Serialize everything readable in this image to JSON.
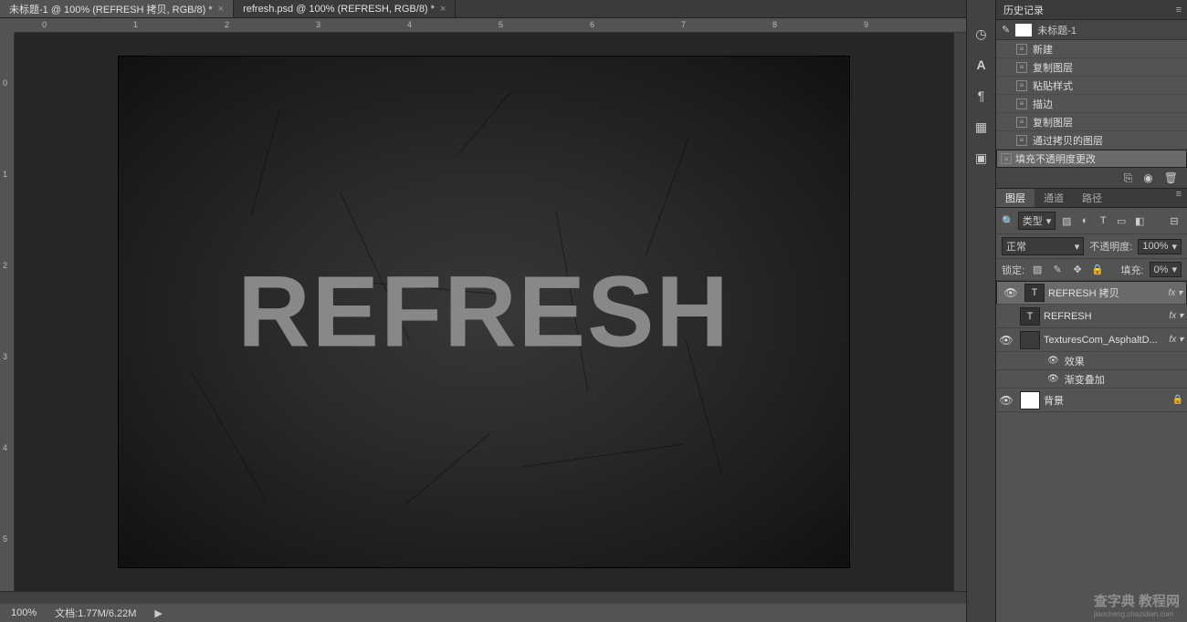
{
  "tabs": [
    {
      "label": "未标题-1 @ 100% (REFRESH 拷贝, RGB/8) *"
    },
    {
      "label": "refresh.psd @ 100% (REFRESH, RGB/8) *"
    }
  ],
  "ruler_h": [
    "0",
    "1",
    "2",
    "3",
    "4",
    "5",
    "6",
    "7",
    "8",
    "9"
  ],
  "ruler_v": [
    "0",
    "1",
    "2",
    "3",
    "4",
    "5"
  ],
  "canvas_text": "REFRESH",
  "status": {
    "zoom": "100%",
    "doc": "文档:1.77M/6.22M"
  },
  "dock": [
    "history",
    "A",
    "paragraph",
    "grid",
    "image"
  ],
  "history": {
    "title": "历史记录",
    "doc": "未标题-1",
    "items": [
      "新建",
      "复制图层",
      "粘贴样式",
      "描边",
      "复制图层",
      "通过拷贝的图层",
      "填充不透明度更改"
    ]
  },
  "layer_tabs": [
    "图层",
    "通道",
    "路径"
  ],
  "filter": {
    "label": "类型",
    "icons": [
      "img",
      "circ",
      "T",
      "rect",
      "fx"
    ]
  },
  "blend": {
    "mode": "正常",
    "opacity_label": "不透明度:",
    "opacity": "100%"
  },
  "lock": {
    "label": "锁定:",
    "fill_label": "填充:",
    "fill": "0%"
  },
  "layers": [
    {
      "eye": true,
      "thumb": "T",
      "name": "REFRESH 拷贝",
      "fx": true,
      "sel": true
    },
    {
      "eye": false,
      "thumb": "T",
      "name": "REFRESH",
      "fx": true
    },
    {
      "eye": true,
      "thumb": "tex",
      "name": "TexturesCom_AsphaltD...",
      "fx": true,
      "subs": [
        "效果",
        "渐变叠加"
      ]
    },
    {
      "eye": true,
      "thumb": "white",
      "name": "背景",
      "lock": true
    }
  ],
  "watermark": {
    "main": "查字典 教程网",
    "sub": "jiaocheng.chazidian.com"
  }
}
